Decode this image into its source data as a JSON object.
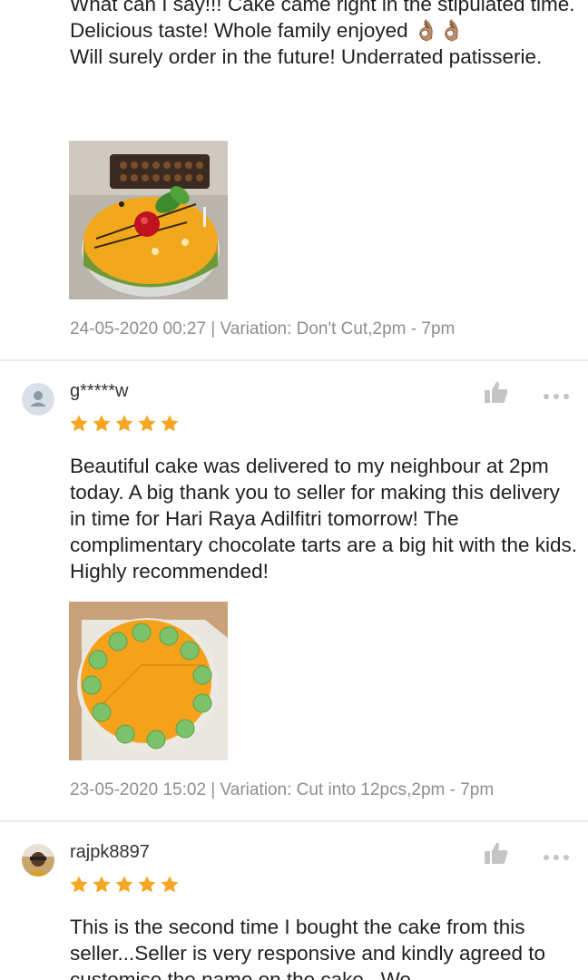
{
  "reviews": [
    {
      "text": "What can I say!!! Cake came right in the stipulated time. Delicious taste! Whole family enjoyed 👌🏽👌🏽\nWill surely order in the future! Underrated patisserie.",
      "meta": "24-05-2020 00:27 | Variation: Don't Cut,2pm - 7pm"
    },
    {
      "username": "g*****w",
      "rating": 5,
      "text": "Beautiful cake was delivered to my neighbour at 2pm today. A big thank you to seller for making this delivery in time for Hari Raya Adilfitri tomorrow! The complimentary chocolate tarts are a big hit with the kids. Highly recommended!",
      "meta": "23-05-2020 15:02 | Variation: Cut into 12pcs,2pm - 7pm"
    },
    {
      "username": "rajpk8897",
      "rating": 5,
      "text": "This is the second time I bought the cake from this seller...Seller is very responsive and kindly agreed to customise the name on the cake...We"
    }
  ],
  "colors": {
    "star": "#f5a623",
    "meta_text": "#8e8e8e",
    "divider": "#ececec",
    "icon_gray": "#c4c4c4"
  },
  "icons": {
    "like": "thumbs-up-icon",
    "more": "more-dots-icon",
    "avatar_default": "user-icon"
  }
}
